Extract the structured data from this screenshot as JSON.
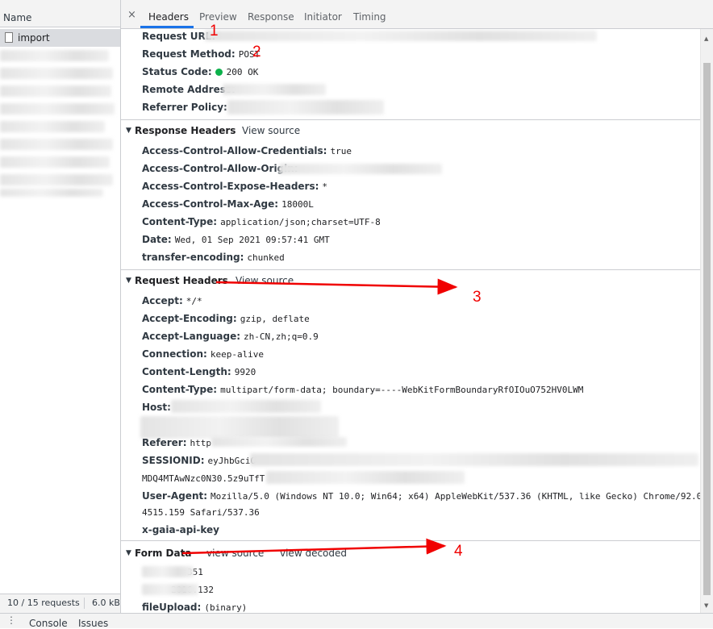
{
  "left_panel": {
    "header": "Name",
    "selected_item": "import",
    "footer_requests": "10 / 15 requests",
    "footer_size": "6.0 kB"
  },
  "tabs": {
    "close": "×",
    "items": [
      "Headers",
      "Preview",
      "Response",
      "Initiator",
      "Timing"
    ],
    "active": "Headers"
  },
  "general": {
    "request_url_label": "Request URL:",
    "request_method_label": "Request Method:",
    "request_method_value": "POST",
    "status_code_label": "Status Code:",
    "status_code_value": "200 OK",
    "status_color": "#0cb14b",
    "remote_address_label": "Remote Address:",
    "referrer_policy_label": "Referrer Policy:",
    "referrer_policy_value": "s"
  },
  "response_headers": {
    "title": "Response Headers",
    "view_source": "View source",
    "items": [
      {
        "k": "Access-Control-Allow-Credentials:",
        "v": "true"
      },
      {
        "k": "Access-Control-Allow-Origin:",
        "v": ""
      },
      {
        "k": "Access-Control-Expose-Headers:",
        "v": "*"
      },
      {
        "k": "Access-Control-Max-Age:",
        "v": "18000L"
      },
      {
        "k": "Content-Type:",
        "v": "application/json;charset=UTF-8"
      },
      {
        "k": "Date:",
        "v": "Wed, 01 Sep 2021 09:57:41 GMT"
      },
      {
        "k": "transfer-encoding:",
        "v": "chunked"
      }
    ]
  },
  "request_headers": {
    "title": "Request Headers",
    "view_source": "View source",
    "items": [
      {
        "k": "Accept:",
        "v": "*/*"
      },
      {
        "k": "Accept-Encoding:",
        "v": "gzip, deflate"
      },
      {
        "k": "Accept-Language:",
        "v": "zh-CN,zh;q=0.9"
      },
      {
        "k": "Connection:",
        "v": "keep-alive"
      },
      {
        "k": "Content-Length:",
        "v": "9920"
      },
      {
        "k": "Content-Type:",
        "v": "multipart/form-data; boundary=----WebKitFormBoundaryRfOIOuO752HV0LWM"
      },
      {
        "k": "Host:",
        "v": ""
      },
      {
        "k": "Referer:",
        "v": "http"
      },
      {
        "k": "SESSIONID:",
        "v": "eyJhbGciO"
      },
      {
        "k": "",
        "v": "MDQ4MTAwNzc0N30.5z9uTfT"
      },
      {
        "k": "User-Agent:",
        "v": "Mozilla/5.0 (Windows NT 10.0; Win64; x64) AppleWebKit/537.36 (KHTML, like Gecko) Chrome/92.0."
      },
      {
        "k": "",
        "v": "4515.159 Safari/537.36"
      },
      {
        "k": "x-gaia-api-key",
        "v": ""
      }
    ]
  },
  "form_data": {
    "title": "Form Data",
    "view_source": "view source",
    "view_decoded": "view decoded",
    "items": [
      {
        "k": "",
        "v": "351"
      },
      {
        "k": "",
        "v": "2016.132"
      },
      {
        "k": "fileUpload:",
        "v": "(binary)"
      }
    ]
  },
  "drawer": {
    "console": "Console",
    "issues": "Issues"
  },
  "annotations": [
    "1",
    "2",
    "3",
    "4"
  ],
  "annotation_color": "#f00000"
}
